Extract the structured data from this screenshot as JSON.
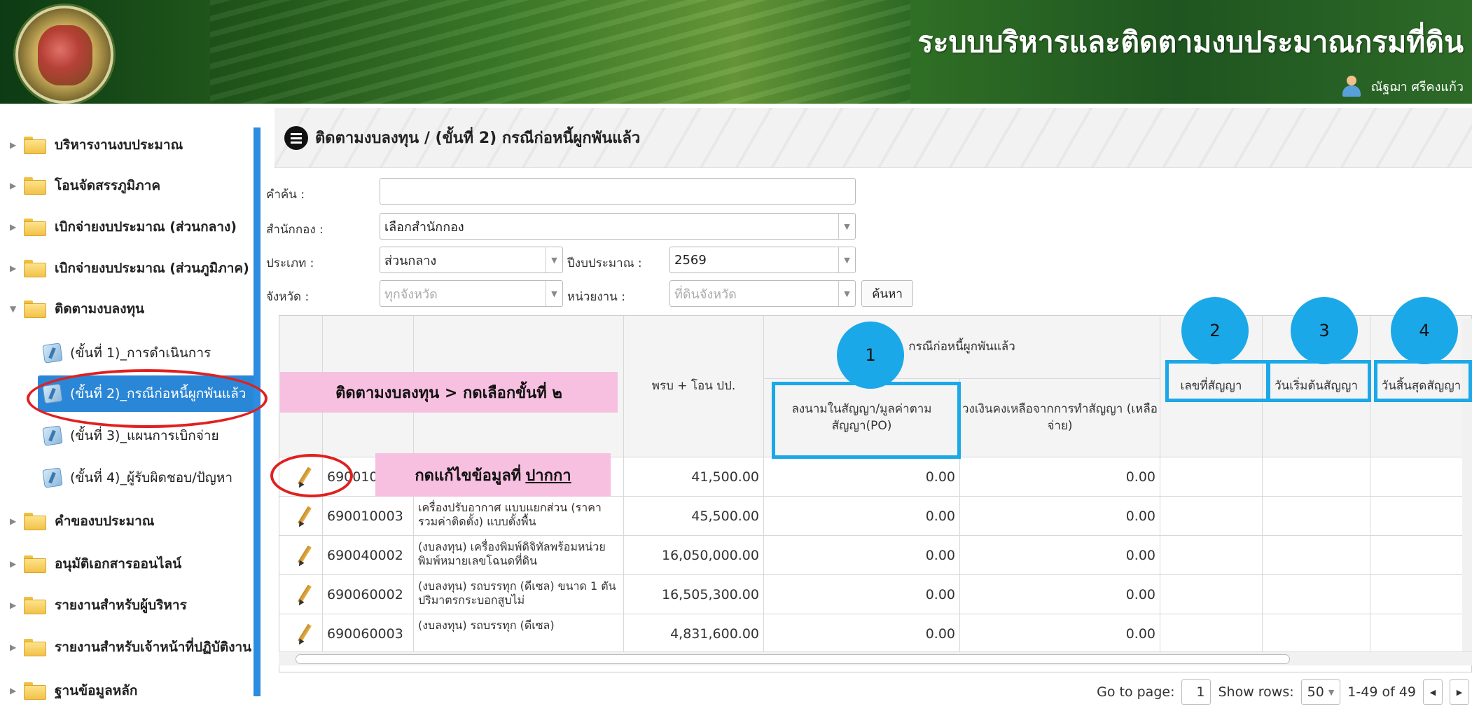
{
  "header": {
    "title": "ระบบบริหารและติดตามงบประมาณกรมที่ดิน",
    "user_name": "ณัฐฌา ศรีคงแก้ว"
  },
  "sidebar": {
    "items": [
      {
        "label": "บริหารงานงบประมาณ"
      },
      {
        "label": "โอนจัดสรรภูมิภาค"
      },
      {
        "label": "เบิกจ่ายงบประมาณ (ส่วนกลาง)"
      },
      {
        "label": "เบิกจ่ายงบประมาณ (ส่วนภูมิภาค)"
      },
      {
        "label": "ติดตามงบลงทุน"
      },
      {
        "label": "คำของบประมาณ"
      },
      {
        "label": "อนุมัติเอกสารออนไลน์"
      },
      {
        "label": "รายงานสำหรับผู้บริหาร"
      },
      {
        "label": "รายงานสำหรับเจ้าหน้าที่ปฏิบัติงาน"
      },
      {
        "label": "ฐานข้อมูลหลัก"
      }
    ],
    "sub_items": [
      {
        "label": "(ขั้นที่ 1)_การดำเนินการ"
      },
      {
        "label": "(ขั้นที่ 2)_กรณีก่อหนี้ผูกพันแล้ว"
      },
      {
        "label": "(ขั้นที่ 3)_แผนการเบิกจ่าย"
      },
      {
        "label": "(ขั้นที่ 4)_ผู้รับผิดชอบ/ปัญหา"
      }
    ]
  },
  "panel": {
    "title": "ติดตามงบลงทุน / (ขั้นที่ 2) กรณีก่อหนี้ผูกพันแล้ว"
  },
  "filters": {
    "keyword_label": "คำค้น :",
    "keyword_value": "",
    "office_label": "สำนักกอง :",
    "office_value": "เลือกสำนักกอง",
    "type_label": "ประเภท :",
    "type_value": "ส่วนกลาง",
    "year_label": "ปีงบประมาณ :",
    "year_value": "2569",
    "province_label": "จังหวัด :",
    "province_value": "ทุกจังหวัด",
    "unit_label": "หน่วยงาน :",
    "unit_value": "ที่ดินจังหวัด",
    "search_button": "ค้นหา"
  },
  "grid": {
    "headers": {
      "budget": "พรบ + โอน ปป.",
      "group": "กรณีก่อหนี้ผูกพันแล้ว",
      "signed": "ลงนามในสัญญา/มูลค่าตามสัญญา(PO)",
      "remaining": "วงเงินคงเหลือจากการทำสัญญา (เหลือจ่าย)",
      "contract_no": "เลขที่สัญญา",
      "start_date": "วันเริ่มต้นสัญญา",
      "end_date": "วันสิ้นสุดสัญญา"
    },
    "rows": [
      {
        "code": "690010",
        "desc": "",
        "budget": "41,500.00",
        "signed": "0.00",
        "remaining": "0.00"
      },
      {
        "code": "690010003",
        "desc": "เครื่องปรับอากาศ แบบแยกส่วน (ราคารวมค่าติดตั้ง) แบบตั้งพื้น",
        "budget": "45,500.00",
        "signed": "0.00",
        "remaining": "0.00"
      },
      {
        "code": "690040002",
        "desc": "(งบลงทุน) เครื่องพิมพ์ดิจิทัลพร้อมหน่วยพิมพ์หมายเลขโฉนดที่ดิน",
        "budget": "16,050,000.00",
        "signed": "0.00",
        "remaining": "0.00"
      },
      {
        "code": "690060002",
        "desc": "(งบลงทุน) รถบรรทุก (ดีเซล) ขนาด 1 ตัน ปริมาตรกระบอกสูบไม่",
        "budget": "16,505,300.00",
        "signed": "0.00",
        "remaining": "0.00"
      },
      {
        "code": "690060003",
        "desc": "(งบลงทุน) รถบรรทุก (ดีเซล)",
        "budget": "4,831,600.00",
        "signed": "0.00",
        "remaining": "0.00"
      }
    ]
  },
  "pager": {
    "goto_label": "Go to page:",
    "page": "1",
    "rows_label": "Show rows:",
    "rows_value": "50",
    "range": "1-49 of 49"
  },
  "annotations": {
    "breadcrumb_note": "ติดตามงบลงทุน > กดเลือกขั้นที่ ๒",
    "edit_note_prefix": "กดแก้ไขข้อมูลที่ ",
    "edit_note_link": "ปากกา",
    "circle_1": "1",
    "circle_2": "2",
    "circle_3": "3",
    "circle_4": "4"
  },
  "colors": {
    "accent": "#2a86d6",
    "annotation_blue": "#1ba8e8",
    "annotation_pink": "#f7c0e0",
    "annotation_red": "#e02020"
  }
}
